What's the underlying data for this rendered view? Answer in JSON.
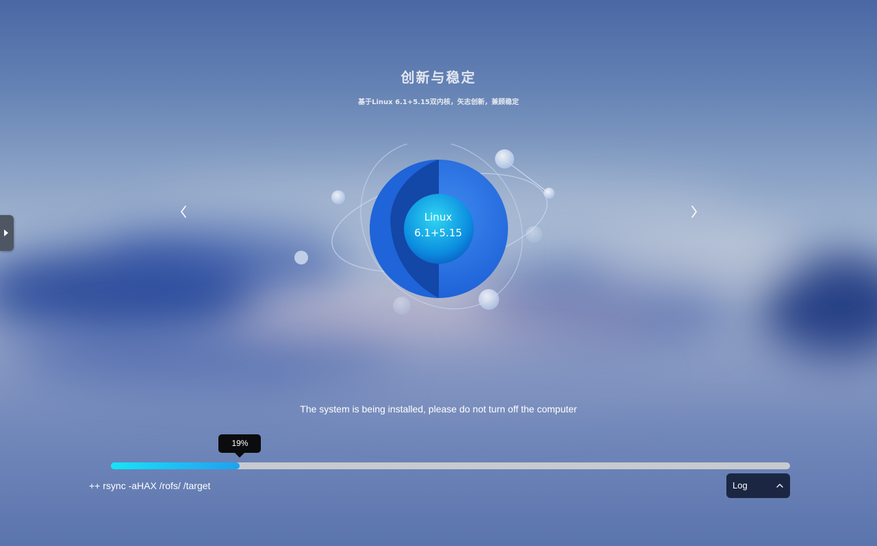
{
  "slide": {
    "title": "创新与稳定",
    "subtitle": "基于Linux 6.1+5.15双内核，矢志创新，兼顾稳定",
    "illustration_label": "Linux\n6.1+5.15"
  },
  "navigation": {
    "prev_icon": "chevron-left-icon",
    "next_icon": "chevron-right-icon"
  },
  "status": {
    "message": "The system is being installed, please do not turn off the computer"
  },
  "progress": {
    "percent": 19,
    "label": "19%"
  },
  "log": {
    "current_line": "++ rsync -aHAX /rofs/ /target",
    "button_label": "Log",
    "button_icon": "chevron-up-icon"
  },
  "side_panel": {
    "toggle_icon": "play-triangle-icon"
  },
  "colors": {
    "progress_start": "#16e4f7",
    "progress_end": "#1ea2ef",
    "track": "#c7cacf",
    "tooltip_bg": "#0b0c0e",
    "log_button_bg": "#1b2742",
    "sphere_blue": "#246ce0"
  }
}
